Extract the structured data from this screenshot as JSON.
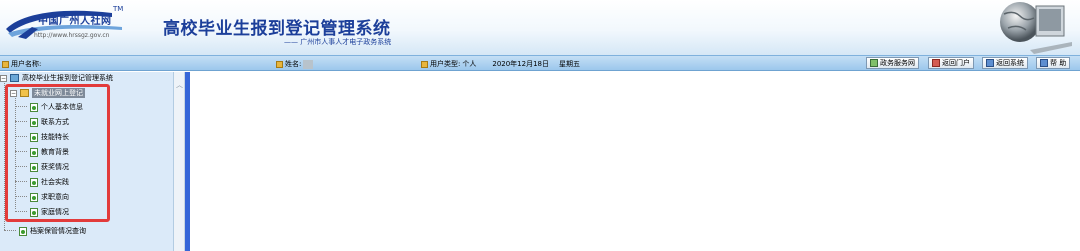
{
  "banner": {
    "logo_text": "中国广州人社网",
    "logo_tm": "TM",
    "logo_url": "http://www.hrssgz.gov.cn",
    "title": "高校毕业生报到登记管理系统",
    "subtitle": "—— 广州市人事人才电子政务系统"
  },
  "infobar": {
    "user_name_label": "用户名称:",
    "name_label": "姓名:",
    "user_type_label": "用户类型:",
    "user_type_value": "个人",
    "date": "2020年12月18日",
    "weekday": "星期五",
    "buttons": [
      {
        "label": "政务服务网",
        "icon": "service-icon"
      },
      {
        "label": "返回门户",
        "icon": "home-icon"
      },
      {
        "label": "返回系统",
        "icon": "system-icon"
      },
      {
        "label": "帮 助",
        "icon": "help-icon"
      }
    ]
  },
  "tree": {
    "root": "高校毕业生报到登记管理系统",
    "group": "未就业网上登记",
    "items": [
      "个人基本信息",
      "联系方式",
      "技能特长",
      "教育背景",
      "获奖情况",
      "社会实践",
      "求职意向",
      "家庭情况"
    ],
    "bottom_item": "档案保管情况查询"
  },
  "colors": {
    "accent": "#1c3f9a",
    "highlight": "#e23b3b",
    "tree_bg": "#dbeaf9",
    "content_bar": "#3666d8"
  }
}
